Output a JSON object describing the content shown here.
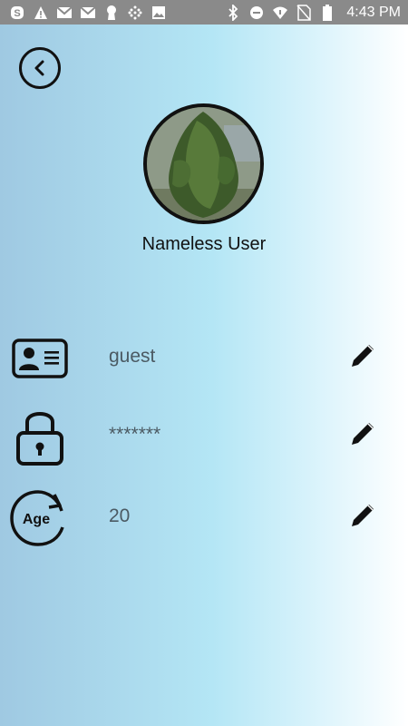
{
  "status_bar": {
    "time": "4:43 PM",
    "left_icons": [
      "skype-icon",
      "warning-icon",
      "gmail-icon",
      "gmail-icon",
      "keyhole-icon",
      "grid-icon",
      "image-icon"
    ],
    "right_icons": [
      "bluetooth-icon",
      "do-not-disturb-icon",
      "wifi-icon",
      "no-sim-icon",
      "battery-icon"
    ]
  },
  "profile": {
    "name": "Nameless User"
  },
  "fields": [
    {
      "icon": "id-card-icon",
      "value": "guest"
    },
    {
      "icon": "lock-icon",
      "value": "*******"
    },
    {
      "icon": "age-icon",
      "value": "20",
      "icon_text": "Age"
    }
  ],
  "colors": {
    "status_bar": "#8a8a8a",
    "gradient_left": "#9fc9e2",
    "gradient_mid": "#b4e6f5",
    "gradient_right": "#ffffff",
    "value_text": "#4b5a63"
  }
}
